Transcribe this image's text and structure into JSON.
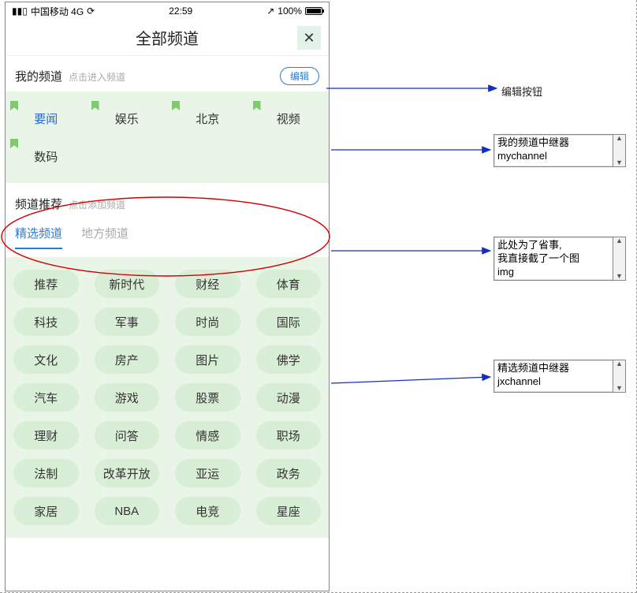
{
  "statusbar": {
    "carrier": "中国移动  4G",
    "time": "22:59",
    "battery": "100%"
  },
  "titlebar": {
    "title": "全部频道",
    "close": "✕"
  },
  "mychannel": {
    "title": "我的频道",
    "hint": "点击进入频道",
    "edit": "编辑",
    "items": [
      "要闻",
      "娱乐",
      "北京",
      "视频",
      "数码"
    ]
  },
  "recommend": {
    "title": "频道推荐",
    "hint": "点击添加频道",
    "tabs": [
      "精选频道",
      "地方频道"
    ]
  },
  "jxchannel": {
    "items": [
      "推荐",
      "新时代",
      "财经",
      "体育",
      "科技",
      "军事",
      "时尚",
      "国际",
      "文化",
      "房产",
      "图片",
      "佛学",
      "汽车",
      "游戏",
      "股票",
      "动漫",
      "理财",
      "问答",
      "情感",
      "职场",
      "法制",
      "改革开放",
      "亚运",
      "政务",
      "家居",
      "NBA",
      "电竞",
      "星座"
    ]
  },
  "annotations": {
    "edit_label": "编辑按钮",
    "mychannel_box_l1": "我的频道中继器",
    "mychannel_box_l2": "mychannel",
    "img_box_l1": "此处为了省事,",
    "img_box_l2": "我直接截了一个图",
    "img_box_l3": "img",
    "jxchannel_box_l1": "精选频道中继器",
    "jxchannel_box_l2": "jxchannel"
  }
}
